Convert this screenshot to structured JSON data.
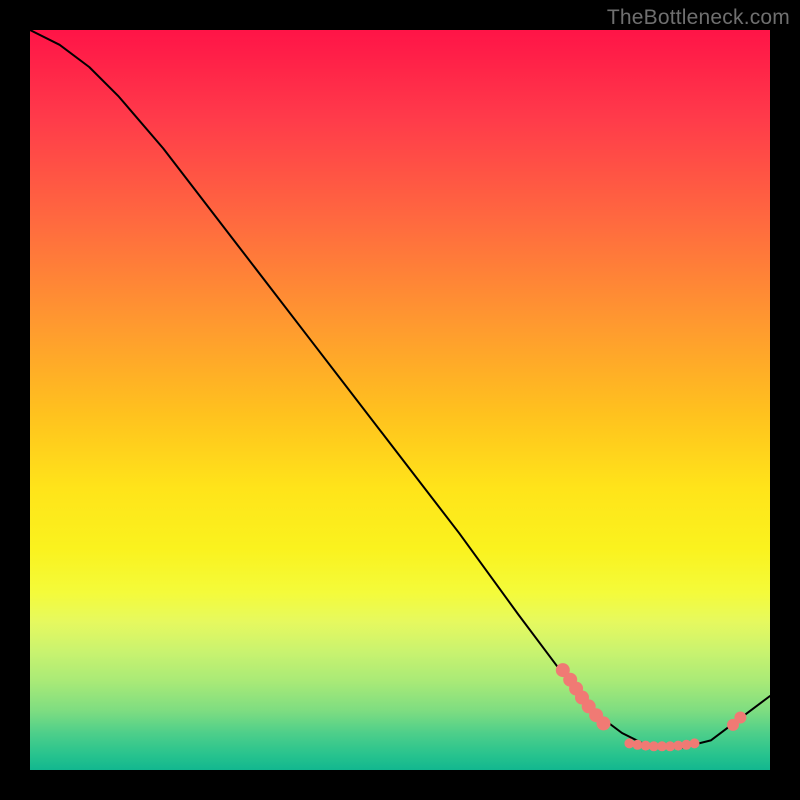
{
  "watermark": "TheBottleneck.com",
  "chart_data": {
    "type": "line",
    "title": "",
    "xlabel": "",
    "ylabel": "",
    "xlim": [
      0,
      100
    ],
    "ylim": [
      0,
      100
    ],
    "curve": {
      "x": [
        0,
        4,
        8,
        12,
        18,
        28,
        38,
        48,
        58,
        66,
        72,
        76,
        80,
        84,
        88,
        92,
        96,
        100
      ],
      "y": [
        100,
        98,
        95,
        91,
        84,
        71,
        58,
        45,
        32,
        21,
        13,
        8,
        5,
        3,
        3,
        4,
        7,
        10
      ]
    },
    "series": [
      {
        "name": "cluster-left",
        "color": "#f07a74",
        "radius": 7,
        "points": [
          {
            "x": 72.0,
            "y": 13.5
          },
          {
            "x": 73.0,
            "y": 12.2
          },
          {
            "x": 73.8,
            "y": 11.0
          },
          {
            "x": 74.6,
            "y": 9.8
          },
          {
            "x": 75.5,
            "y": 8.6
          },
          {
            "x": 76.5,
            "y": 7.4
          },
          {
            "x": 77.5,
            "y": 6.3
          }
        ]
      },
      {
        "name": "bottom-row",
        "color": "#f07a74",
        "radius": 5,
        "points": [
          {
            "x": 81.0,
            "y": 3.6
          },
          {
            "x": 82.1,
            "y": 3.4
          },
          {
            "x": 83.2,
            "y": 3.3
          },
          {
            "x": 84.3,
            "y": 3.2
          },
          {
            "x": 85.4,
            "y": 3.2
          },
          {
            "x": 86.5,
            "y": 3.2
          },
          {
            "x": 87.6,
            "y": 3.3
          },
          {
            "x": 88.7,
            "y": 3.4
          },
          {
            "x": 89.8,
            "y": 3.6
          }
        ]
      },
      {
        "name": "right-pair",
        "color": "#f07a74",
        "radius": 6,
        "points": [
          {
            "x": 95.0,
            "y": 6.1
          },
          {
            "x": 96.0,
            "y": 7.1
          }
        ]
      }
    ],
    "legend": false,
    "grid": false
  },
  "colors": {
    "curve_stroke": "#000000",
    "point_fill": "#f07a74"
  }
}
